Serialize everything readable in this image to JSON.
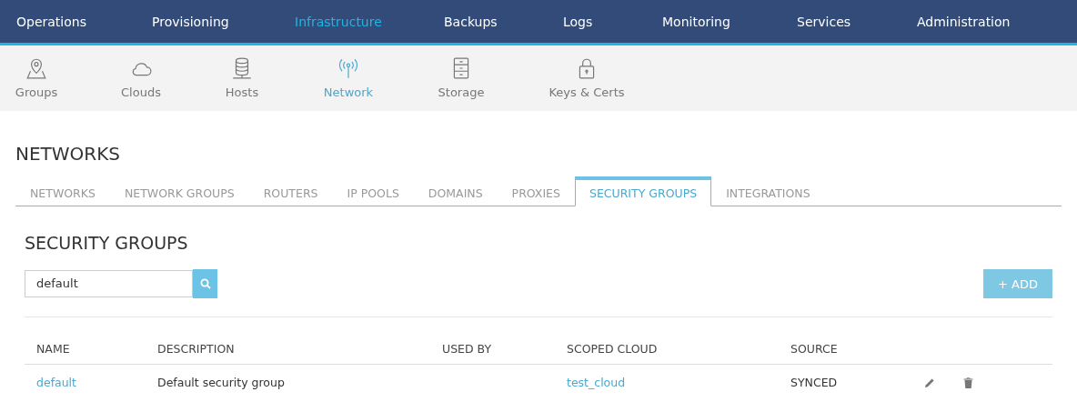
{
  "top_nav": [
    {
      "label": "Operations",
      "selected": false
    },
    {
      "label": "Provisioning",
      "selected": false
    },
    {
      "label": "Infrastructure",
      "selected": true
    },
    {
      "label": "Backups",
      "selected": false
    },
    {
      "label": "Logs",
      "selected": false
    },
    {
      "label": "Monitoring",
      "selected": false
    },
    {
      "label": "Services",
      "selected": false
    },
    {
      "label": "Administration",
      "selected": false
    }
  ],
  "sub_nav": [
    {
      "label": "Groups",
      "selected": false
    },
    {
      "label": "Clouds",
      "selected": false
    },
    {
      "label": "Hosts",
      "selected": false
    },
    {
      "label": "Network",
      "selected": true
    },
    {
      "label": "Storage",
      "selected": false
    },
    {
      "label": "Keys & Certs",
      "selected": false
    }
  ],
  "page_title": "NETWORKS",
  "tabs": [
    {
      "label": "NETWORKS",
      "selected": false
    },
    {
      "label": "NETWORK GROUPS",
      "selected": false
    },
    {
      "label": "ROUTERS",
      "selected": false
    },
    {
      "label": "IP POOLS",
      "selected": false
    },
    {
      "label": "DOMAINS",
      "selected": false
    },
    {
      "label": "PROXIES",
      "selected": false
    },
    {
      "label": "SECURITY GROUPS",
      "selected": true
    },
    {
      "label": "INTEGRATIONS",
      "selected": false
    }
  ],
  "section_title": "SECURITY GROUPS",
  "search": {
    "value": "default"
  },
  "add_button": "+ ADD",
  "table": {
    "columns": [
      "NAME",
      "DESCRIPTION",
      "USED BY",
      "SCOPED CLOUD",
      "SOURCE"
    ],
    "rows": [
      {
        "name": "default",
        "description": "Default security group",
        "scoped_cloud": "test_cloud",
        "source": "SYNCED"
      }
    ]
  }
}
